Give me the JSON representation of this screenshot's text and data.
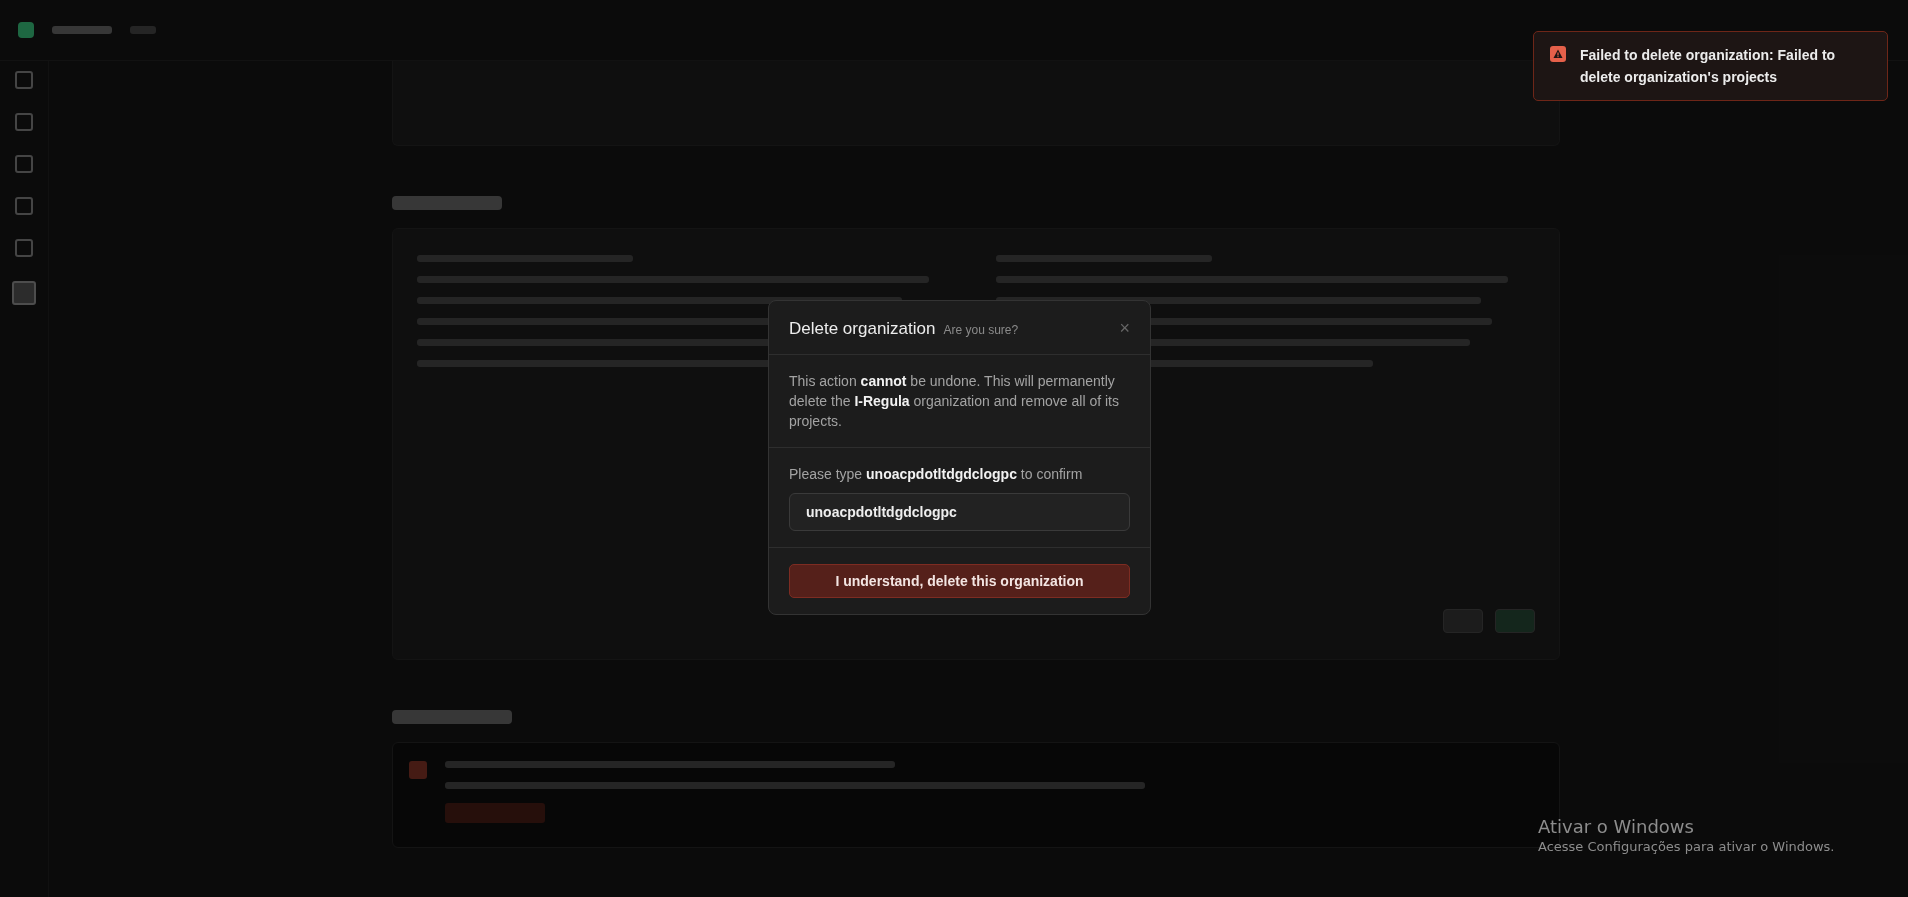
{
  "dialog": {
    "title": "Delete organization",
    "subtitle": "Are you sure?",
    "close": "×",
    "description": "This action **cannot** be undone. This will permanently delete the **I-Regula** organization and remove all of its projects.",
    "confirm_label": "Please type **unoacpdotltdgdclogpc** to confirm",
    "input_value": "unoacpdotltdgdclogpc",
    "button": "I understand, delete this organization"
  },
  "toast": {
    "message": "Failed to delete organization: Failed to delete organization's projects"
  },
  "os_notice": {
    "title": "Ativar o Windows",
    "text": "Acesse Configurações para ativar o Windows."
  }
}
